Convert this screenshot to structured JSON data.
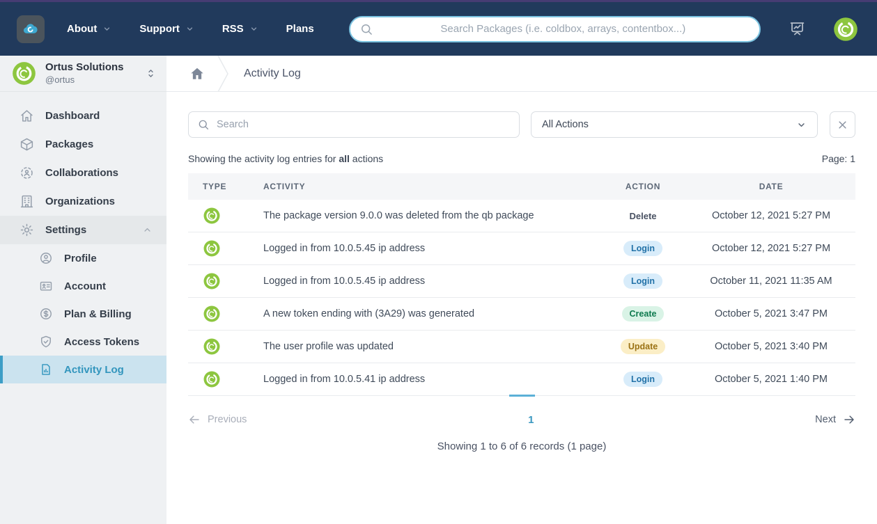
{
  "theme": {
    "navbar_bg": "#213a5c",
    "top_strip": "#463c73",
    "brand_green": "#8dc63f",
    "active_blue": "#3295bd",
    "active_bg": "#cbe3ef",
    "badge_login_bg": "#d8ecfa",
    "badge_login_text": "#2272a8",
    "badge_create_bg": "#d9f3e6",
    "badge_create_text": "#0e7a4e",
    "badge_update_bg": "#fbeec6",
    "badge_update_text": "#9b7214",
    "page_indicator": "#5bb0d7"
  },
  "navbar": {
    "links": [
      {
        "label": "About",
        "has_caret": true
      },
      {
        "label": "Support",
        "has_caret": true
      },
      {
        "label": "RSS",
        "has_caret": true
      },
      {
        "label": "Plans",
        "has_caret": false
      }
    ],
    "search_placeholder": "Search Packages (i.e. coldbox, arrays, contentbox...)"
  },
  "sidebar": {
    "org": {
      "name": "Ortus Solutions",
      "handle": "@ortus"
    },
    "items": [
      {
        "label": "Dashboard",
        "icon": "i-home",
        "sub": false,
        "expanded": false,
        "active": false
      },
      {
        "label": "Packages",
        "icon": "i-cube",
        "sub": false,
        "expanded": false,
        "active": false
      },
      {
        "label": "Collaborations",
        "icon": "i-collab",
        "sub": false,
        "expanded": false,
        "active": false
      },
      {
        "label": "Organizations",
        "icon": "i-building",
        "sub": false,
        "expanded": false,
        "active": false
      },
      {
        "label": "Settings",
        "icon": "i-gear",
        "sub": false,
        "expanded": true,
        "active": false
      },
      {
        "label": "Profile",
        "icon": "i-user",
        "sub": true,
        "expanded": false,
        "active": false
      },
      {
        "label": "Account",
        "icon": "i-idcard",
        "sub": true,
        "expanded": false,
        "active": false
      },
      {
        "label": "Plan & Billing",
        "icon": "i-dollar",
        "sub": true,
        "expanded": false,
        "active": false
      },
      {
        "label": "Access Tokens",
        "icon": "i-shield",
        "sub": true,
        "expanded": false,
        "active": false
      },
      {
        "label": "Activity Log",
        "icon": "i-docchart",
        "sub": true,
        "expanded": false,
        "active": true
      }
    ]
  },
  "breadcrumb": {
    "page_title": "Activity Log"
  },
  "filters": {
    "search_placeholder": "Search",
    "action_filter_value": "All Actions"
  },
  "status": {
    "prefix": "Showing the activity log entries for ",
    "highlight": "all",
    "suffix": " actions",
    "page_label": "Page: 1"
  },
  "table": {
    "headers": [
      "TYPE",
      "ACTIVITY",
      "ACTION",
      "DATE"
    ],
    "rows": [
      {
        "activity": "The package version 9.0.0 was deleted from the qb package",
        "action": "Delete",
        "action_style": "plain",
        "date": "October 12, 2021 5:27 PM"
      },
      {
        "activity": "Logged in from 10.0.5.45 ip address",
        "action": "Login",
        "action_style": "blue",
        "date": "October 12, 2021 5:27 PM"
      },
      {
        "activity": "Logged in from 10.0.5.45 ip address",
        "action": "Login",
        "action_style": "blue",
        "date": "October 11, 2021 11:35 AM"
      },
      {
        "activity": "A new token ending with (3A29) was generated",
        "action": "Create",
        "action_style": "green",
        "date": "October 5, 2021 3:47 PM"
      },
      {
        "activity": "The user profile was updated",
        "action": "Update",
        "action_style": "yellow",
        "date": "October 5, 2021 3:40 PM"
      },
      {
        "activity": "Logged in from 10.0.5.41 ip address",
        "action": "Login",
        "action_style": "blue",
        "date": "October 5, 2021 1:40 PM"
      }
    ]
  },
  "pagination": {
    "previous_label": "Previous",
    "current_page": "1",
    "next_label": "Next",
    "summary": "Showing 1 to 6 of 6 records (1 page)"
  }
}
